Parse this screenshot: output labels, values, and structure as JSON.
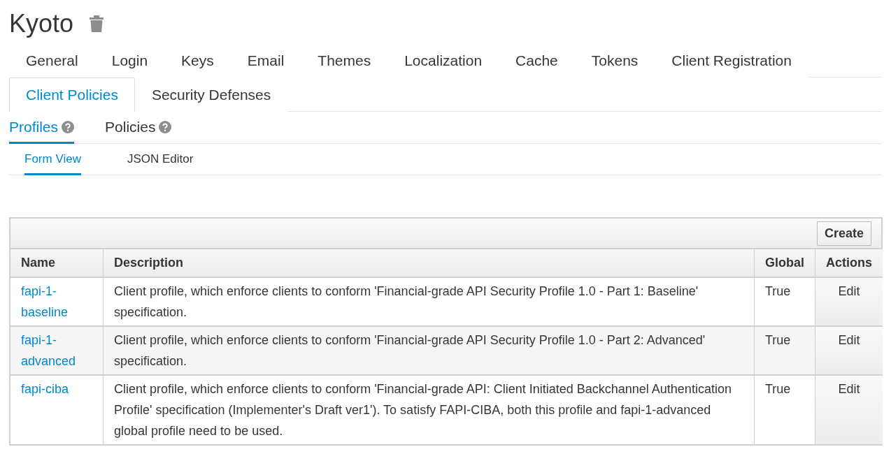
{
  "title": "Kyoto",
  "tabs": [
    {
      "label": "General",
      "selected": false
    },
    {
      "label": "Login",
      "selected": false
    },
    {
      "label": "Keys",
      "selected": false
    },
    {
      "label": "Email",
      "selected": false
    },
    {
      "label": "Themes",
      "selected": false
    },
    {
      "label": "Localization",
      "selected": false
    },
    {
      "label": "Cache",
      "selected": false
    },
    {
      "label": "Tokens",
      "selected": false
    },
    {
      "label": "Client Registration",
      "selected": false
    },
    {
      "label": "Client Policies",
      "selected": true
    },
    {
      "label": "Security Defenses",
      "selected": false
    }
  ],
  "subtabs": [
    {
      "label": "Profiles",
      "selected": true
    },
    {
      "label": "Policies",
      "selected": false
    }
  ],
  "view_tabs": [
    {
      "label": "Form View",
      "selected": true
    },
    {
      "label": "JSON Editor",
      "selected": false
    }
  ],
  "table": {
    "create_button": "Create",
    "columns": [
      "Name",
      "Description",
      "Global",
      "Actions"
    ],
    "rows": [
      {
        "name": "fapi-1-baseline",
        "description": "Client profile, which enforce clients to conform 'Financial-grade API Security Profile 1.0 - Part 1: Baseline' specification.",
        "global": "True",
        "action": "Edit"
      },
      {
        "name": "fapi-1-advanced",
        "description": "Client profile, which enforce clients to conform 'Financial-grade API Security Profile 1.0 - Part 2: Advanced' specification.",
        "global": "True",
        "action": "Edit"
      },
      {
        "name": "fapi-ciba",
        "description": "Client profile, which enforce clients to conform 'Financial-grade API: Client Initiated Backchannel Authentication Profile' specification (Implementer's Draft ver1'). To satisfy FAPI-CIBA, both this profile and fapi-1-advanced global profile need to be used.",
        "global": "True",
        "action": "Edit"
      }
    ]
  }
}
